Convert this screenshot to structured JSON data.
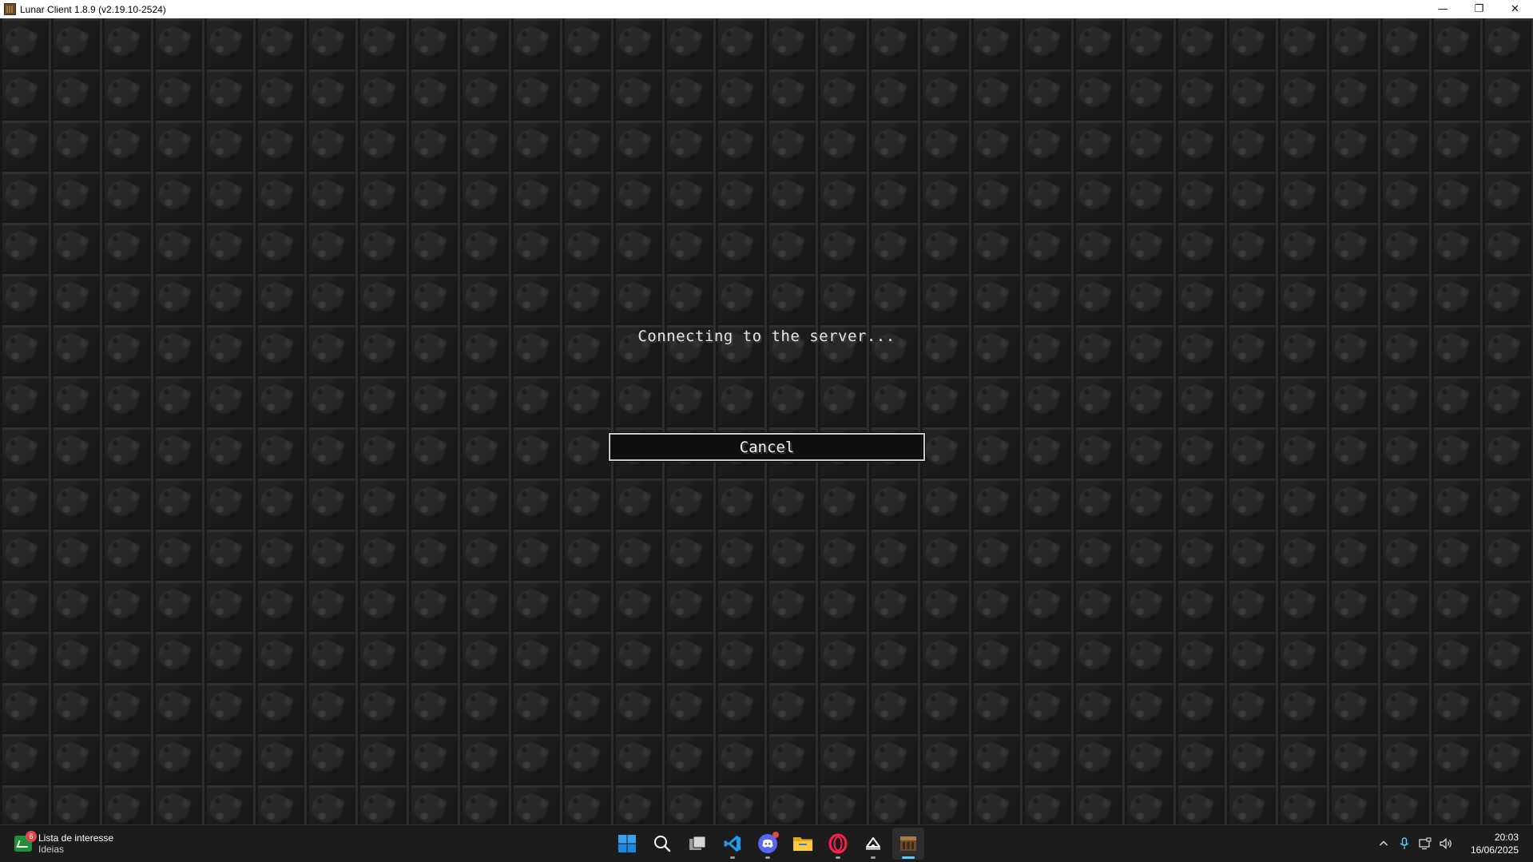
{
  "window": {
    "title": "Lunar Client 1.8.9 (v2.19.10-2524)",
    "app_icon": "crafting-table-icon",
    "controls": {
      "minimize": "—",
      "restore": "❐",
      "close": "✕"
    }
  },
  "screen": {
    "status": "Connecting to the server...",
    "cancel_label": "Cancel"
  },
  "taskbar": {
    "widget": {
      "icon": "stock-chart-icon",
      "badge": "6",
      "title": "Lista de interesse",
      "subtitle": "Ideias"
    },
    "apps": [
      {
        "name": "start-button",
        "icon": "windows-logo-icon"
      },
      {
        "name": "search-button",
        "icon": "search-icon"
      },
      {
        "name": "task-view-button",
        "icon": "task-view-icon"
      },
      {
        "name": "vscode-app",
        "icon": "vscode-icon"
      },
      {
        "name": "discord-app",
        "icon": "discord-icon"
      },
      {
        "name": "file-explorer-app",
        "icon": "folder-icon"
      },
      {
        "name": "opera-gx-app",
        "icon": "opera-icon"
      },
      {
        "name": "lunar-launcher-app",
        "icon": "lunar-icon"
      },
      {
        "name": "lunar-client-app",
        "icon": "crafting-table-icon"
      }
    ],
    "tray": {
      "chevron": "^",
      "clock": {
        "time": "20:03",
        "date": "16/06/2025"
      }
    }
  },
  "colors": {
    "accent": "#60cdff",
    "badge": "#e0474c",
    "button_border": "#c9c9c9",
    "text": "#e6e6e6"
  }
}
